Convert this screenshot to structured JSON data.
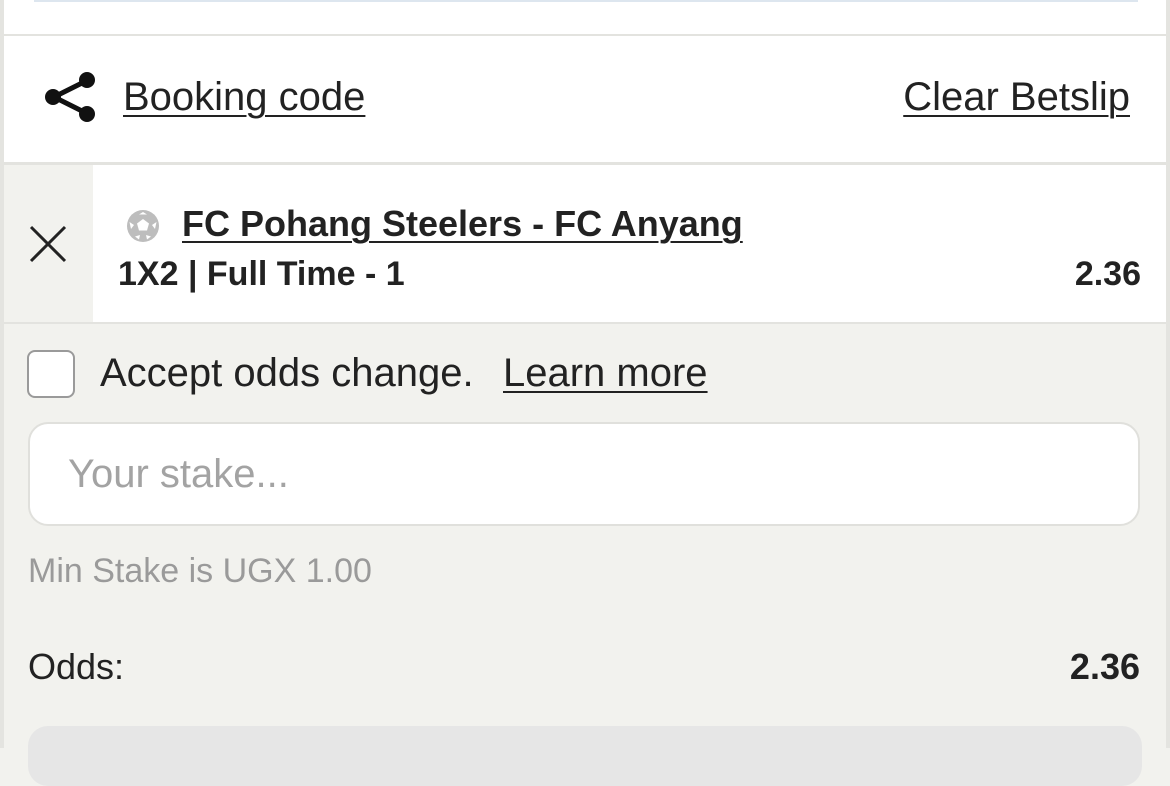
{
  "header": {
    "share_icon": "share-icon",
    "booking_label": "Booking code",
    "clear_label": "Clear Betslip"
  },
  "selection": {
    "remove_icon": "close-icon",
    "sport_icon": "soccer-ball-icon",
    "match": "FC Pohang Steelers - FC Anyang",
    "market": "1X2 | Full Time - 1",
    "odds": "2.36"
  },
  "options": {
    "accept_odds_label": "Accept odds change.",
    "learn_more_label": "Learn more",
    "accept_odds_checked": false
  },
  "stake": {
    "placeholder": "Your stake...",
    "value": "",
    "min_stake_text": "Min Stake is UGX 1.00"
  },
  "summary": {
    "odds_label": "Odds:",
    "odds_value": "2.36"
  },
  "colors": {
    "background": "#f2f2ee",
    "card": "#ffffff",
    "text": "#222222",
    "muted": "#9a9a9a"
  }
}
